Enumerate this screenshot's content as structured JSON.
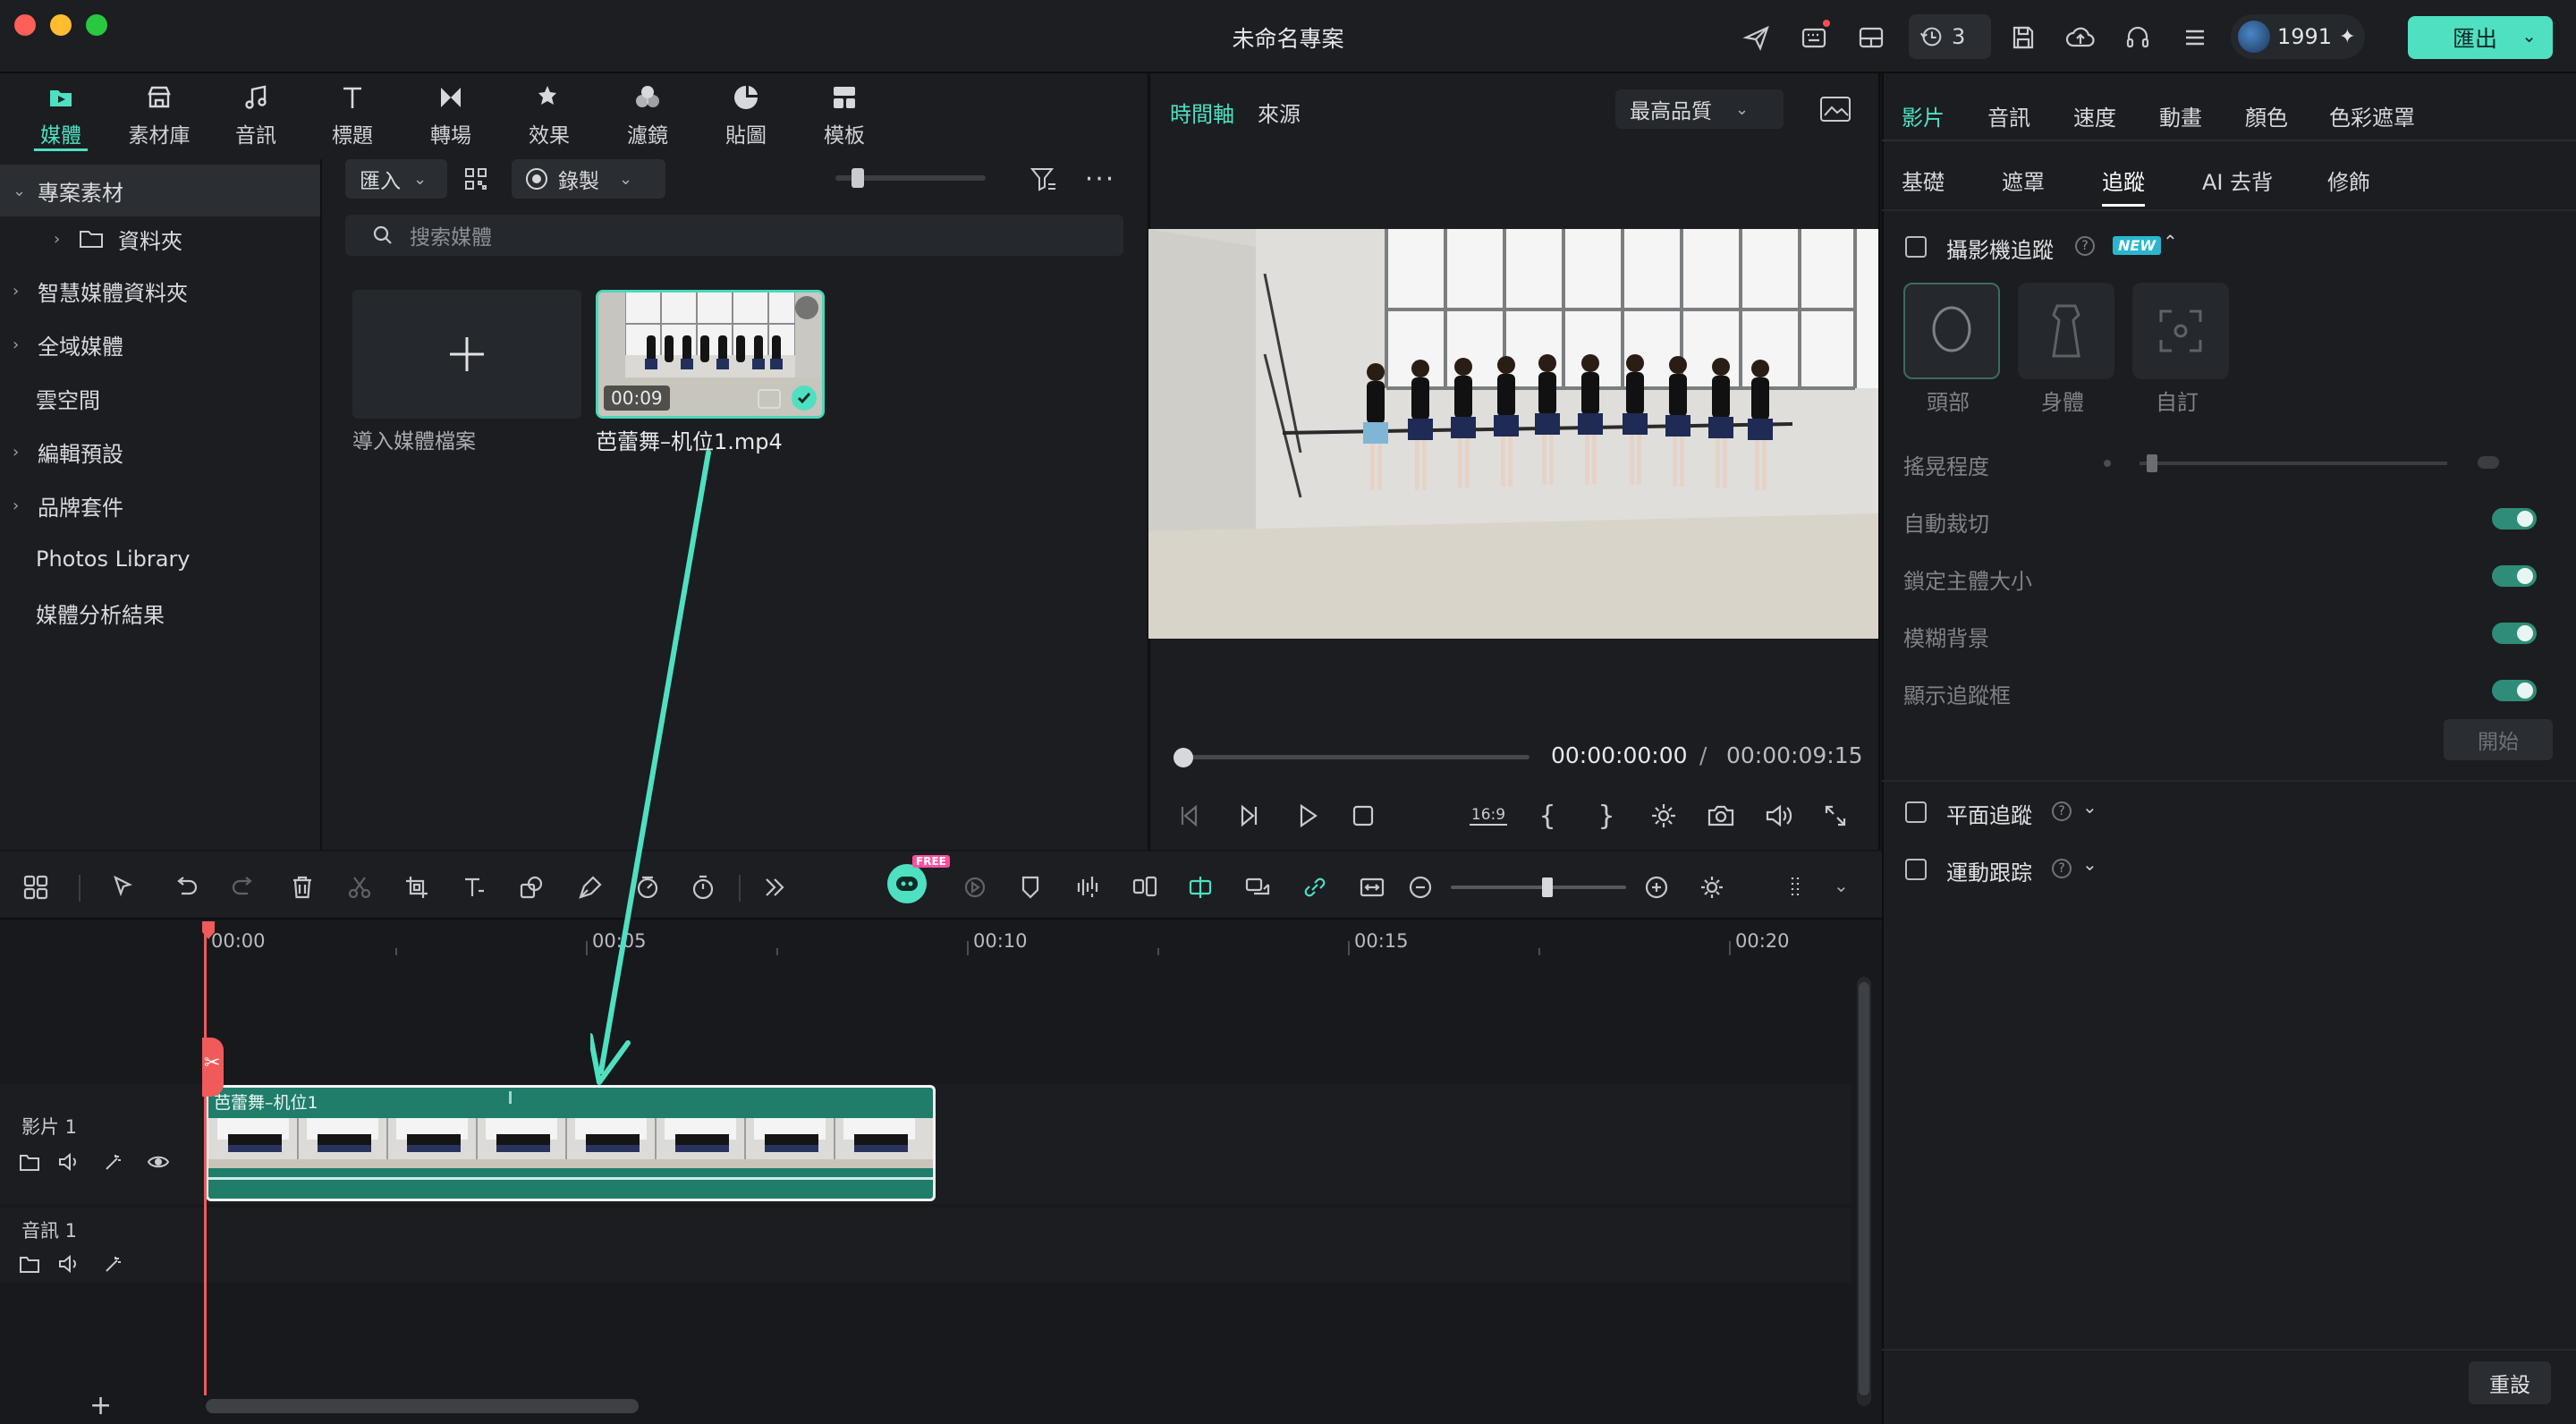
{
  "window": {
    "title": "未命名專案",
    "notification_count": "3",
    "credits": "1991",
    "export_label": "匯出"
  },
  "media_tabs": [
    {
      "label": "媒體",
      "icon": "media-icon",
      "active": true
    },
    {
      "label": "素材庫",
      "icon": "store-icon"
    },
    {
      "label": "音訊",
      "icon": "music-icon"
    },
    {
      "label": "標題",
      "icon": "title-icon"
    },
    {
      "label": "轉場",
      "icon": "transition-icon"
    },
    {
      "label": "效果",
      "icon": "effects-icon"
    },
    {
      "label": "濾鏡",
      "icon": "filter-icon"
    },
    {
      "label": "貼圖",
      "icon": "sticker-icon"
    },
    {
      "label": "模板",
      "icon": "template-icon"
    }
  ],
  "sidebar": {
    "items": [
      {
        "label": "專案素材",
        "expanded": true
      },
      {
        "label": "資料夾"
      },
      {
        "label": "智慧媒體資料夾"
      },
      {
        "label": "全域媒體"
      },
      {
        "label": "雲空間"
      },
      {
        "label": "編輯預設"
      },
      {
        "label": "品牌套件"
      },
      {
        "label": "Photos Library"
      },
      {
        "label": "媒體分析結果"
      }
    ]
  },
  "media": {
    "import_label": "匯入",
    "record_label": "錄製",
    "search_placeholder": "搜索媒體",
    "import_card_label": "導入媒體檔案",
    "clip": {
      "name": "芭蕾舞–机位1.mp4",
      "duration": "00:09"
    }
  },
  "preview": {
    "tab_timeline": "時間軸",
    "tab_source": "來源",
    "quality": "最高品質",
    "current_time": "00:00:00:00",
    "separator": "/",
    "total_time": "00:00:09:15",
    "aspect": "16:9"
  },
  "properties": {
    "tabs": [
      "影片",
      "音訊",
      "速度",
      "動畫",
      "顏色",
      "色彩遮罩"
    ],
    "subtabs": [
      "基礎",
      "遮罩",
      "追蹤",
      "AI 去背",
      "修飾"
    ],
    "camera_tracking": {
      "label": "攝影機追蹤",
      "badge": "NEW",
      "modes": [
        "頭部",
        "身體",
        "自訂"
      ],
      "shake_label": "搖晃程度",
      "options": [
        "自動裁切",
        "鎖定主體大小",
        "模糊背景",
        "顯示追蹤框"
      ],
      "start_label": "開始"
    },
    "planar_tracking": "平面追蹤",
    "motion_tracking": "運動跟踪",
    "reset_label": "重設"
  },
  "timeline": {
    "ruler": [
      "00:00",
      "00:05",
      "00:10",
      "00:15",
      "00:20"
    ],
    "ai_badge": "FREE",
    "video_track_label": "影片 1",
    "audio_track_label": "音訊 1",
    "clip_title": "芭蕾舞–机位1"
  },
  "colors": {
    "accent": "#4ee0c1",
    "clip_green": "#1f7d6a",
    "playhead": "#f05a5a"
  }
}
